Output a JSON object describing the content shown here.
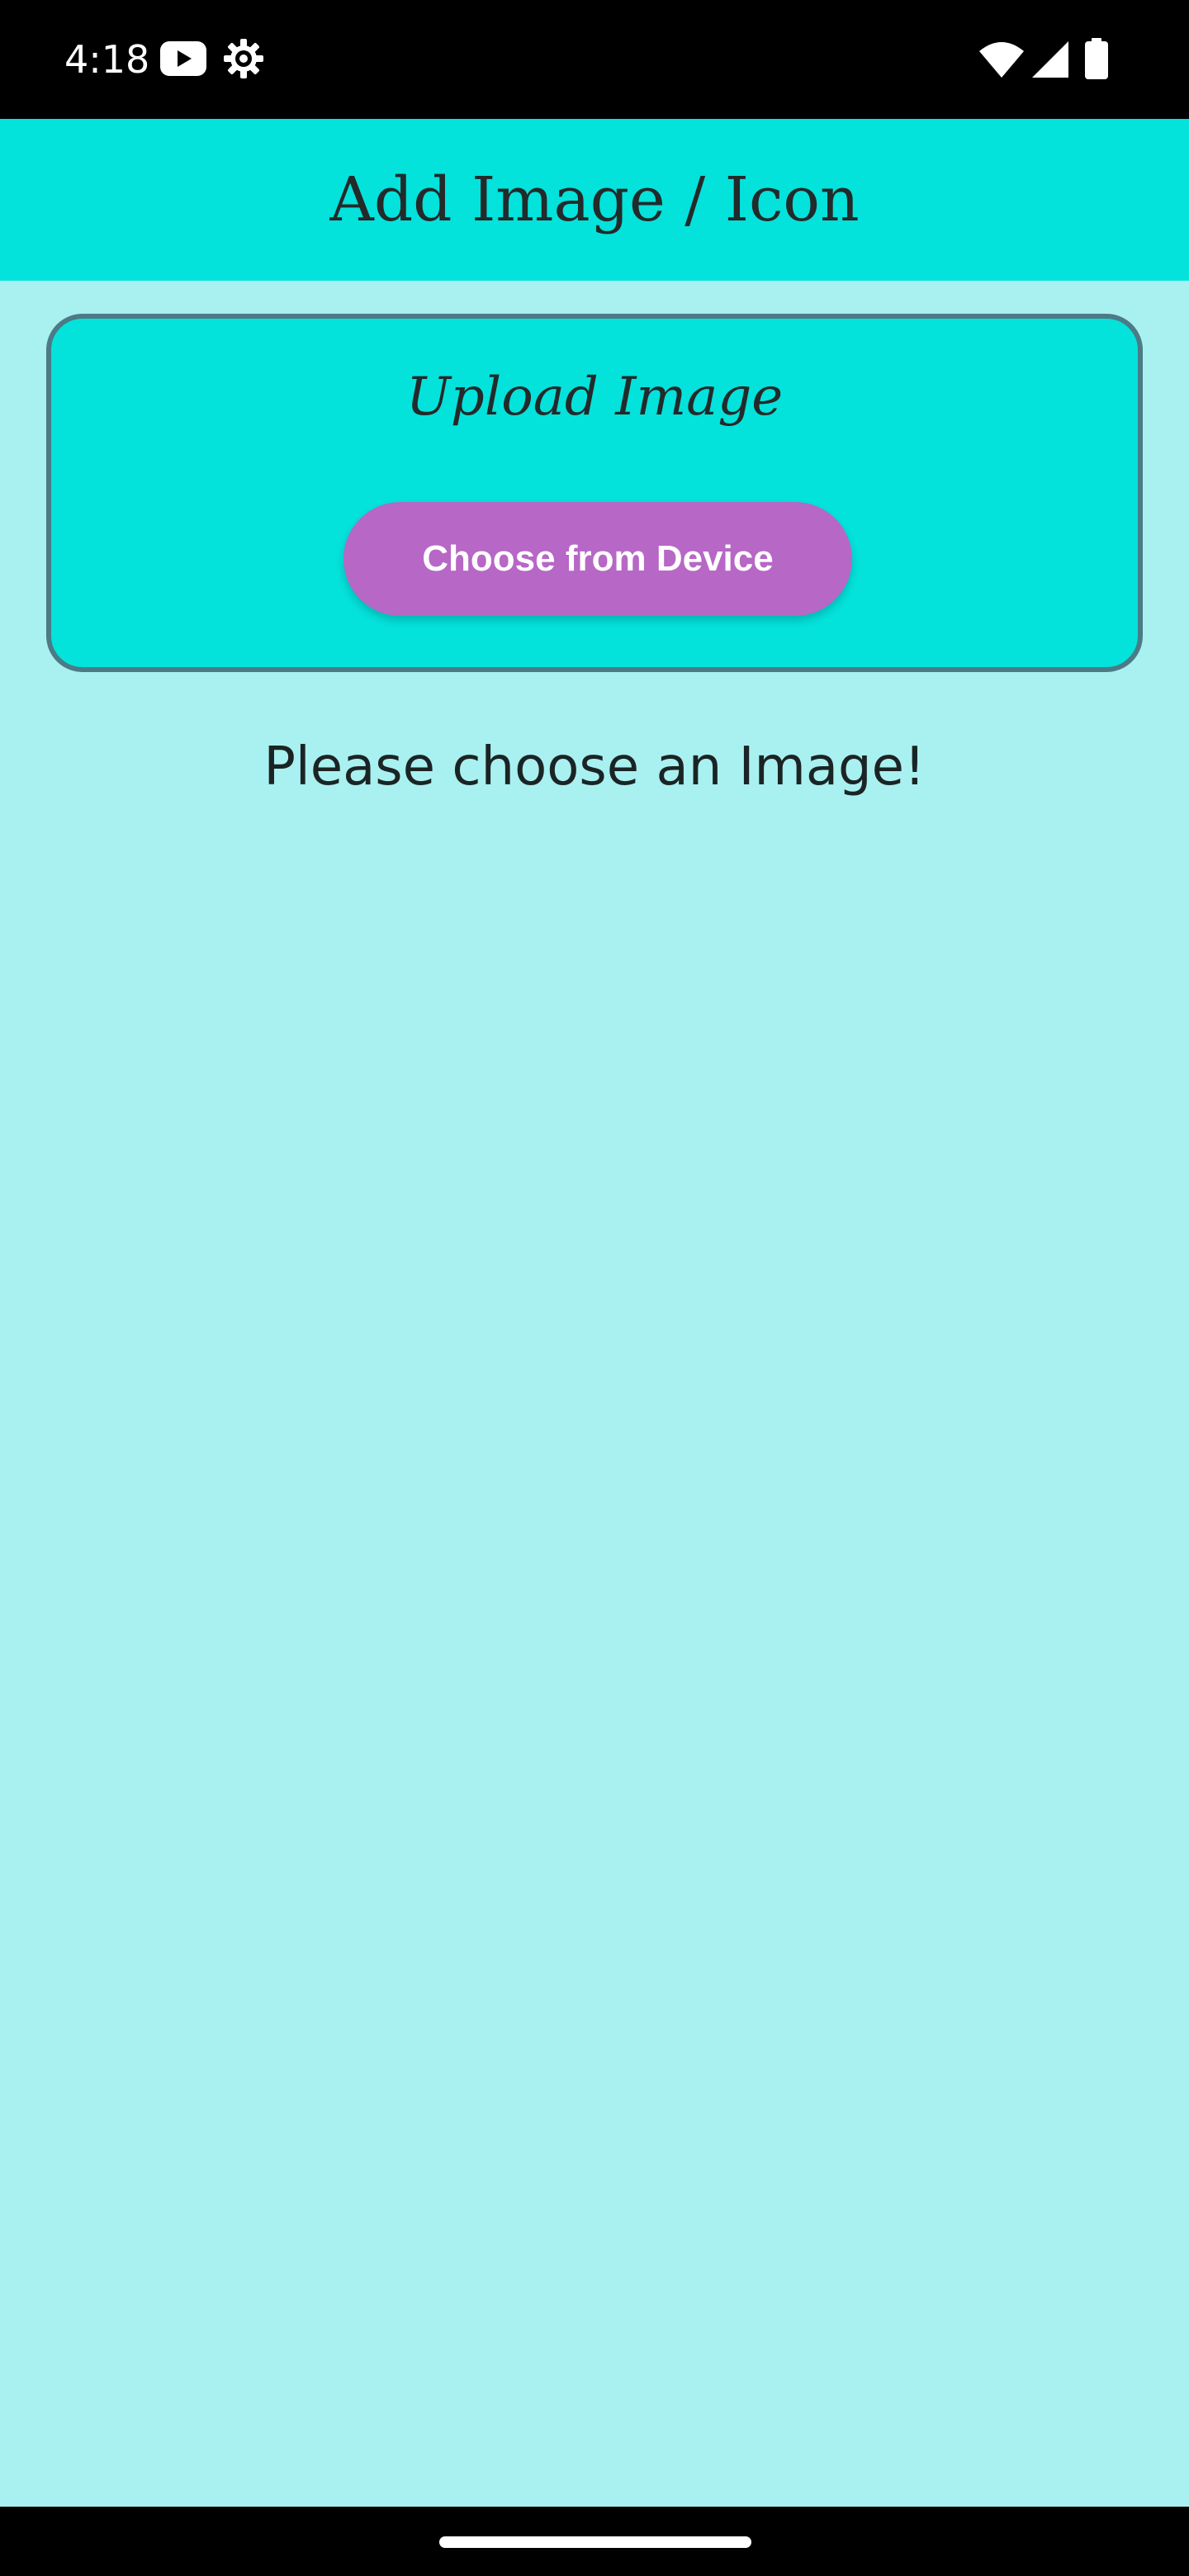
{
  "status_bar": {
    "time": "4:18",
    "left_icons": [
      "youtube-icon",
      "settings-gear-icon"
    ],
    "right_icons": [
      "wifi-icon",
      "cellular-signal-icon",
      "battery-icon"
    ]
  },
  "app_bar": {
    "title": "Add Image / Icon"
  },
  "upload_card": {
    "title": "Upload Image",
    "button_label": "Choose from Device"
  },
  "message": "Please choose an Image!",
  "colors": {
    "background": "#a9f0f1",
    "app_bar": "#04e2dc",
    "card_border": "#4c7a85",
    "button": "#b767c6"
  }
}
